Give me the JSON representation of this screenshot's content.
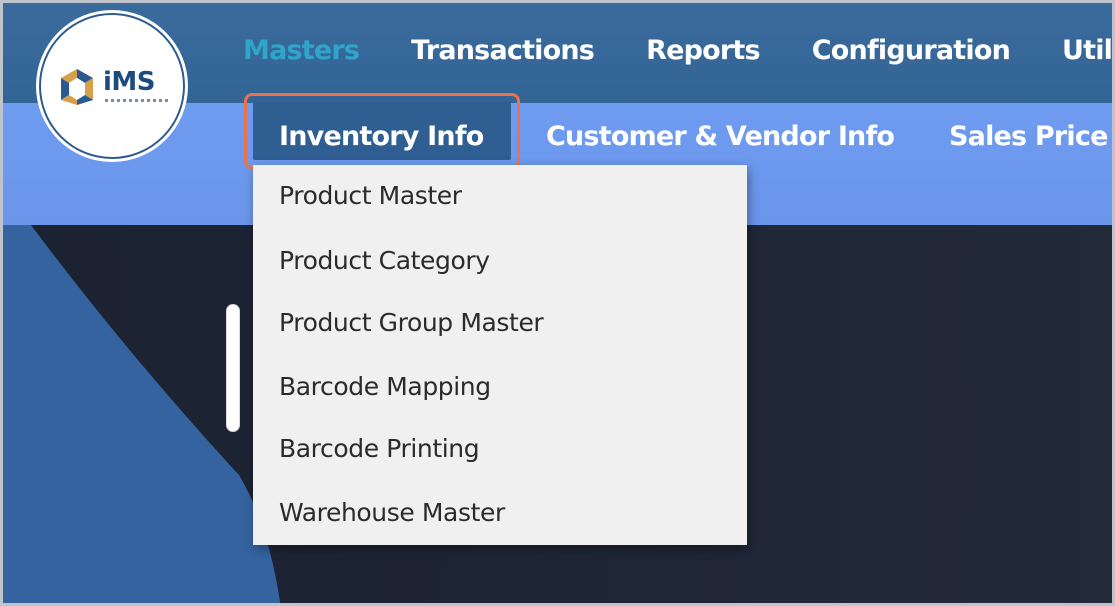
{
  "brand": {
    "logo_text": "iMS",
    "colors": {
      "topbar": "#336699",
      "subbar": "#6f9bef",
      "active_nav": "#2fa6c9",
      "selected_outline": "#e8744a"
    }
  },
  "top_nav": {
    "items": [
      {
        "label": "Masters",
        "active": true
      },
      {
        "label": "Transactions",
        "active": false
      },
      {
        "label": "Reports",
        "active": false
      },
      {
        "label": "Configuration",
        "active": false
      },
      {
        "label": "Utilities",
        "active": false
      }
    ]
  },
  "sub_nav": {
    "items": [
      {
        "label": "Inventory Info",
        "selected": true
      },
      {
        "label": "Customer & Vendor Info",
        "selected": false
      },
      {
        "label": "Sales Price In",
        "selected": false
      }
    ]
  },
  "dropdown": {
    "items": [
      {
        "label": "Product Master"
      },
      {
        "label": "Product Category"
      },
      {
        "label": "Product Group Master"
      },
      {
        "label": "Barcode Mapping"
      },
      {
        "label": "Barcode Printing"
      },
      {
        "label": "Warehouse Master"
      }
    ]
  }
}
